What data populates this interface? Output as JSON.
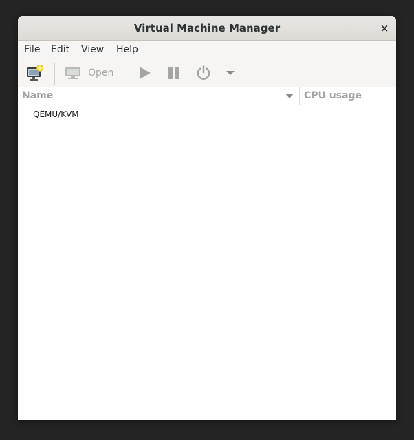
{
  "window": {
    "title": "Virtual Machine Manager",
    "close_glyph": "×"
  },
  "menu": {
    "items": [
      "File",
      "Edit",
      "View",
      "Help"
    ]
  },
  "toolbar": {
    "new_vm_icon": "new-vm-icon",
    "open_icon": "monitor-icon",
    "open_label": "Open",
    "run_icon": "play-icon",
    "pause_icon": "pause-icon",
    "shutdown_icon": "power-icon",
    "shutdown_menu_icon": "chevron-down-icon"
  },
  "columns": {
    "name": "Name",
    "cpu": "CPU usage"
  },
  "connections": [
    {
      "label": "QEMU/KVM"
    }
  ],
  "colors": {
    "accent_disabled": "#a7a9a6",
    "header_text": "#a1a4a0",
    "background": "#242424"
  }
}
